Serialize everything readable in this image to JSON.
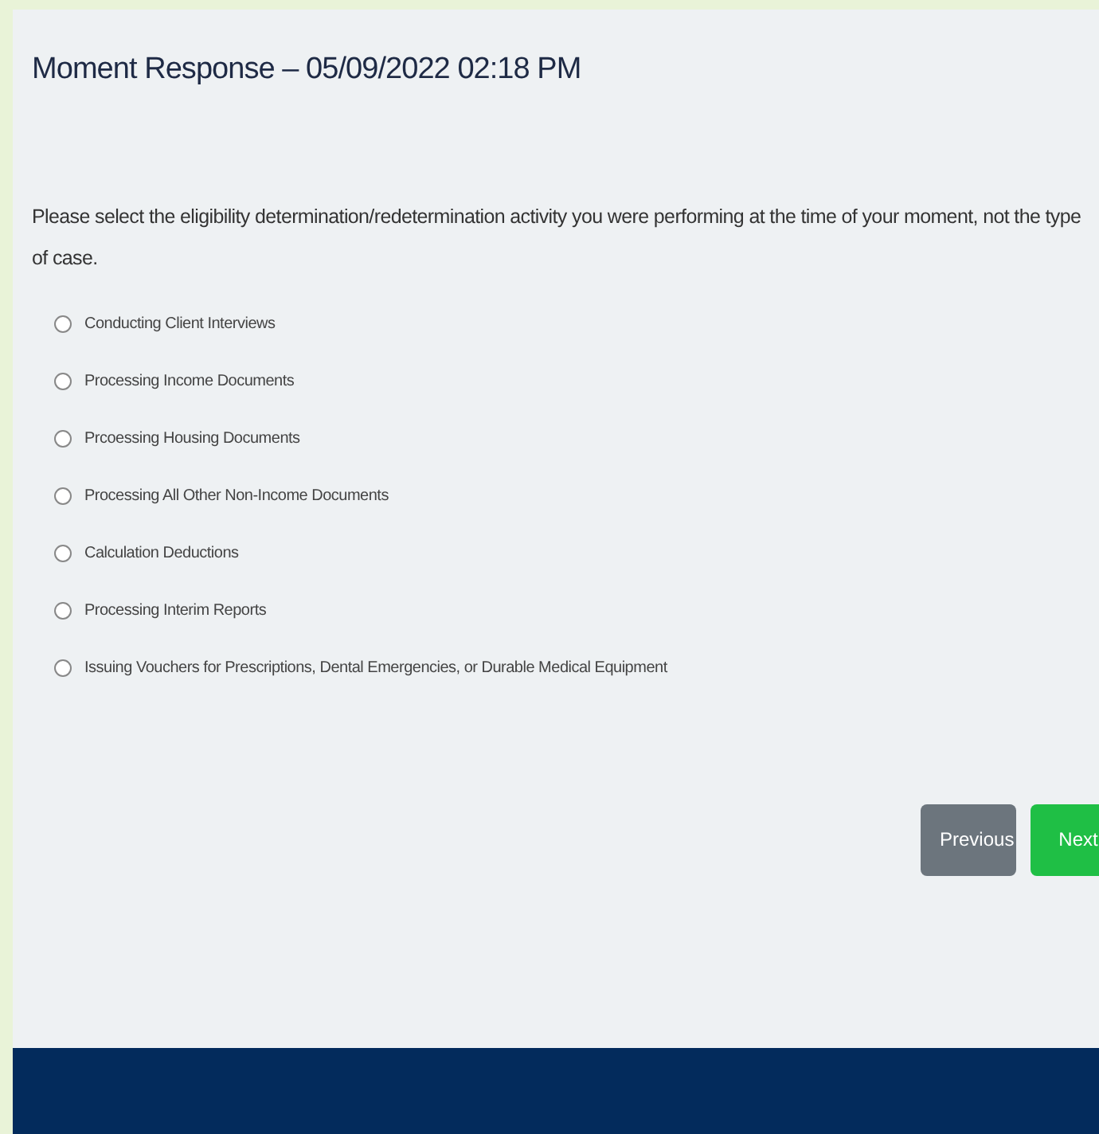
{
  "title": "Moment Response – 05/09/2022 02:18 PM",
  "question": "Please select the eligibility determination/redetermination activity you were performing at the time of your moment, not the type of case.",
  "options": [
    {
      "label": "Conducting Client Interviews",
      "selected": false
    },
    {
      "label": "Processing Income Documents",
      "selected": false
    },
    {
      "label": "Prcoessing Housing Documents",
      "selected": false
    },
    {
      "label": "Processing All Other Non-Income Documents",
      "selected": false
    },
    {
      "label": "Calculation Deductions",
      "selected": false
    },
    {
      "label": "Processing Interim Reports",
      "selected": false
    },
    {
      "label": "Issuing Vouchers for Prescriptions, Dental Emergencies, or Durable Medical Equipment",
      "selected": false
    }
  ],
  "buttons": [
    {
      "label": "Previous",
      "kind": "secondary"
    },
    {
      "label": "Next",
      "kind": "primary"
    }
  ]
}
